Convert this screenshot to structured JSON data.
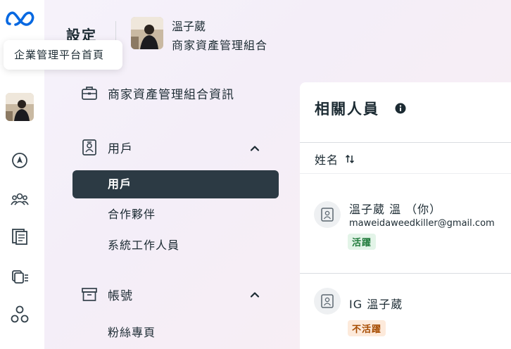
{
  "tooltip": {
    "text": "企業管理平台首頁"
  },
  "header": {
    "settings_title": "設定",
    "profile_name": "溫子葳",
    "portfolio_name": "商家資產管理組合"
  },
  "nav": {
    "business_info": {
      "label": "商家資產管理組合資訊",
      "icon": "briefcase-icon"
    },
    "users": {
      "label": "用戶",
      "icon": "id-badge-icon",
      "expanded": true,
      "items": [
        {
          "label": "用戶",
          "active": true
        },
        {
          "label": "合作夥伴",
          "active": false
        },
        {
          "label": "系統工作人員",
          "active": false
        }
      ]
    },
    "accounts": {
      "label": "帳號",
      "icon": "archive-box-icon",
      "expanded": true,
      "items": [
        {
          "label": "粉絲專頁",
          "active": false
        }
      ]
    }
  },
  "panel": {
    "title": "相關人員",
    "column_header": "姓名",
    "people": [
      {
        "name": "溫子葳 溫 （你）",
        "email": "maweidaweedkiller@gmail.com",
        "status": "活躍",
        "status_type": "active"
      },
      {
        "name": "IG 溫子葳",
        "email": "",
        "status": "不活躍",
        "status_type": "inactive"
      }
    ]
  },
  "colors": {
    "meta_blue": "#0668E1",
    "active_nav_bg": "#2c3a44",
    "badge_active_bg": "#e3f4e8",
    "badge_active_text": "#1f7a3a",
    "badge_inactive_bg": "#fdeadb",
    "badge_inactive_text": "#a64b00"
  }
}
